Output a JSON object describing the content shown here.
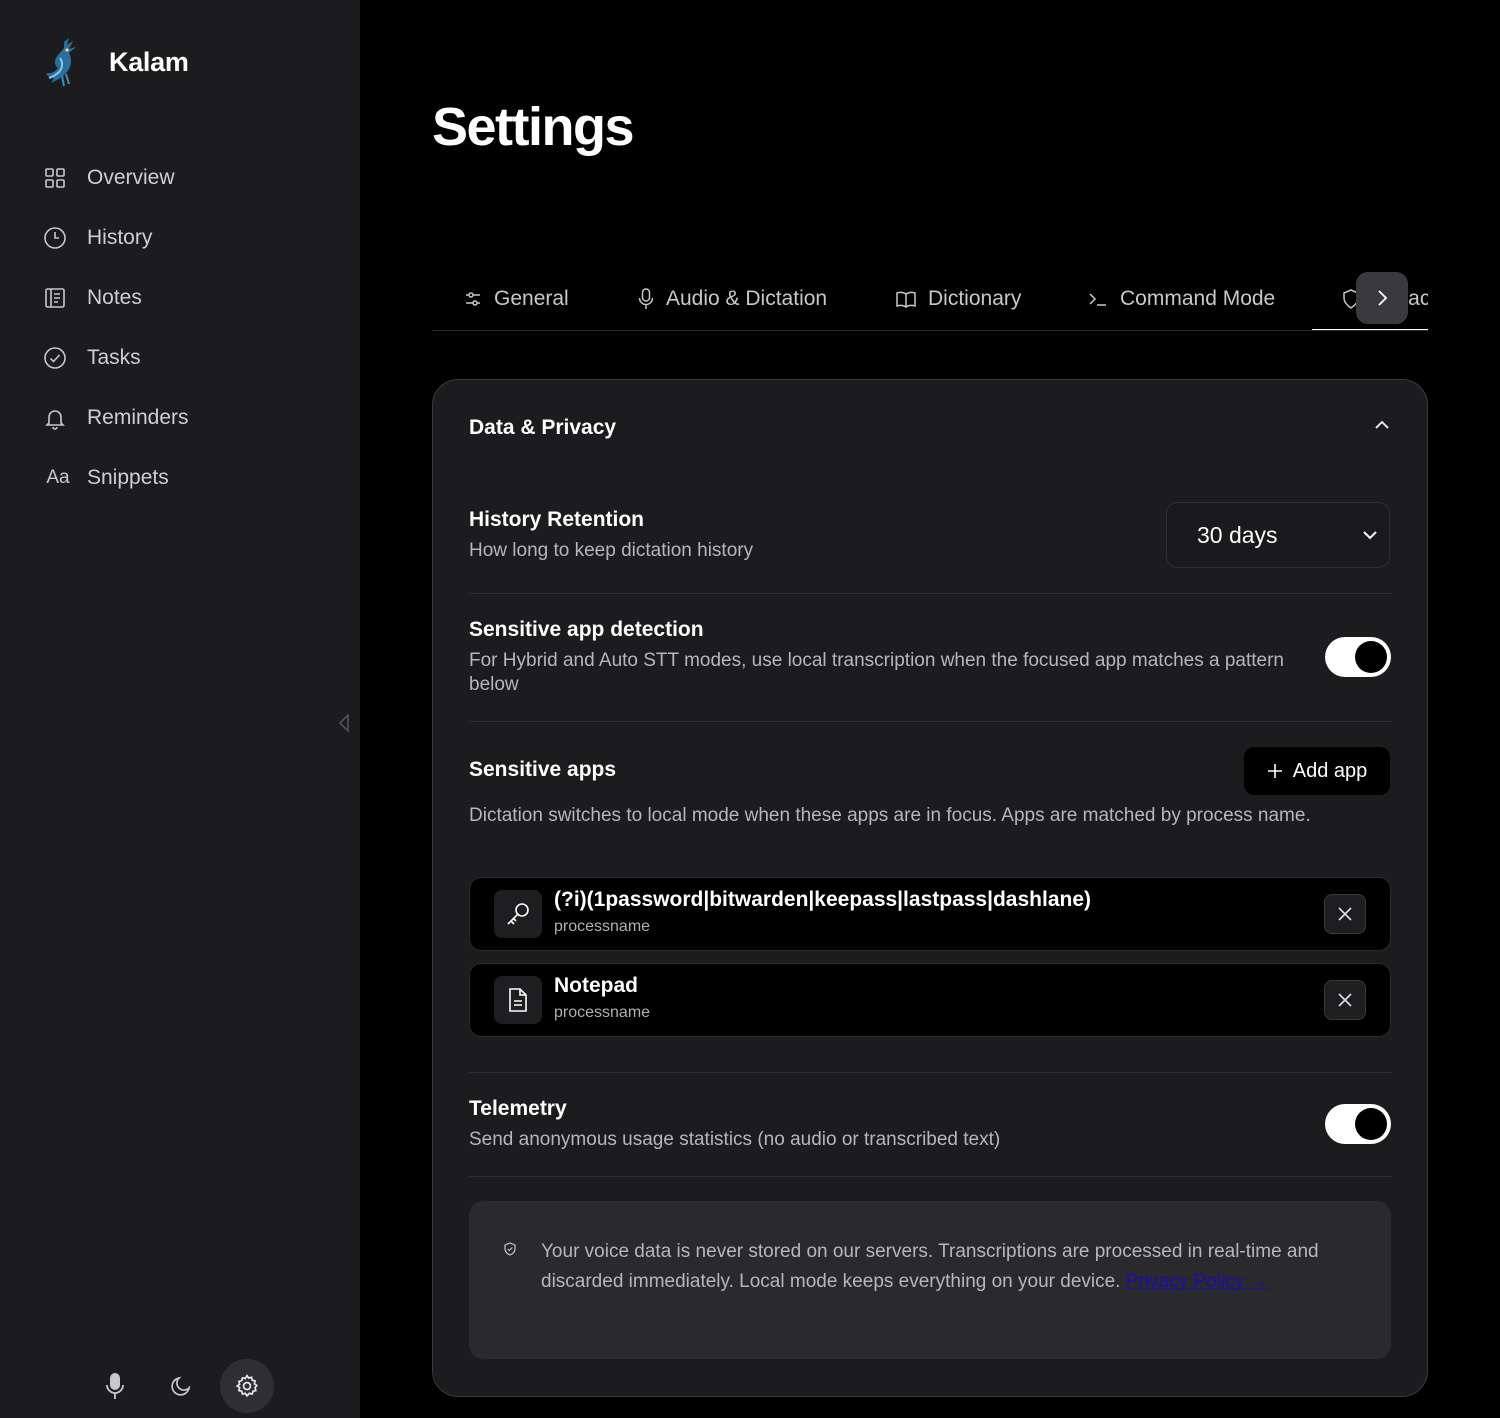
{
  "app": {
    "name": "Kalam"
  },
  "sidebar": {
    "items": [
      {
        "label": "Overview",
        "icon": "grid-icon"
      },
      {
        "label": "History",
        "icon": "clock-icon"
      },
      {
        "label": "Notes",
        "icon": "notebook-icon"
      },
      {
        "label": "Tasks",
        "icon": "check-circle-icon"
      },
      {
        "label": "Reminders",
        "icon": "bell-icon"
      },
      {
        "label": "Snippets",
        "icon": "text-aa-icon"
      }
    ],
    "bottom_icons": [
      "microphone-icon",
      "moon-icon",
      "gear-icon"
    ]
  },
  "page": {
    "title": "Settings"
  },
  "tabs": [
    {
      "label": "General",
      "icon": "sliders-icon"
    },
    {
      "label": "Audio & Dictation",
      "icon": "microphone-icon"
    },
    {
      "label": "Dictionary",
      "icon": "book-icon"
    },
    {
      "label": "Command Mode",
      "icon": "terminal-icon"
    },
    {
      "label": "Privacy",
      "icon": "shield-icon",
      "active": true
    }
  ],
  "section": {
    "title": "Data & Privacy",
    "history_retention": {
      "title": "History Retention",
      "description": "How long to keep dictation history",
      "value": "30 days"
    },
    "sensitive_detection": {
      "title": "Sensitive app detection",
      "description": "For Hybrid and Auto STT modes, use local transcription when the focused app matches a pattern below",
      "enabled": true
    },
    "sensitive_apps": {
      "title": "Sensitive apps",
      "add_label": "Add app",
      "description": "Dictation switches to local mode when these apps are in focus. Apps are matched by process name.",
      "apps": [
        {
          "name": "(?i)(1password|bitwarden|keepass|lastpass|dashlane)",
          "type": "processname",
          "icon": "key-icon"
        },
        {
          "name": "Notepad",
          "type": "processname",
          "icon": "file-text-icon"
        }
      ]
    },
    "telemetry": {
      "title": "Telemetry",
      "description": "Send anonymous usage statistics (no audio or transcribed text)",
      "enabled": true
    },
    "notice": {
      "text": "Your voice data is never stored on our servers. Transcriptions are processed in real-time and discarded immediately. Local mode keeps everything on your device. ",
      "link": "Privacy Policy →"
    }
  },
  "colors": {
    "background": "#000000",
    "sidebar": "#1c1c1e",
    "card": "#1c1c1e",
    "link": "#1a0dab"
  }
}
